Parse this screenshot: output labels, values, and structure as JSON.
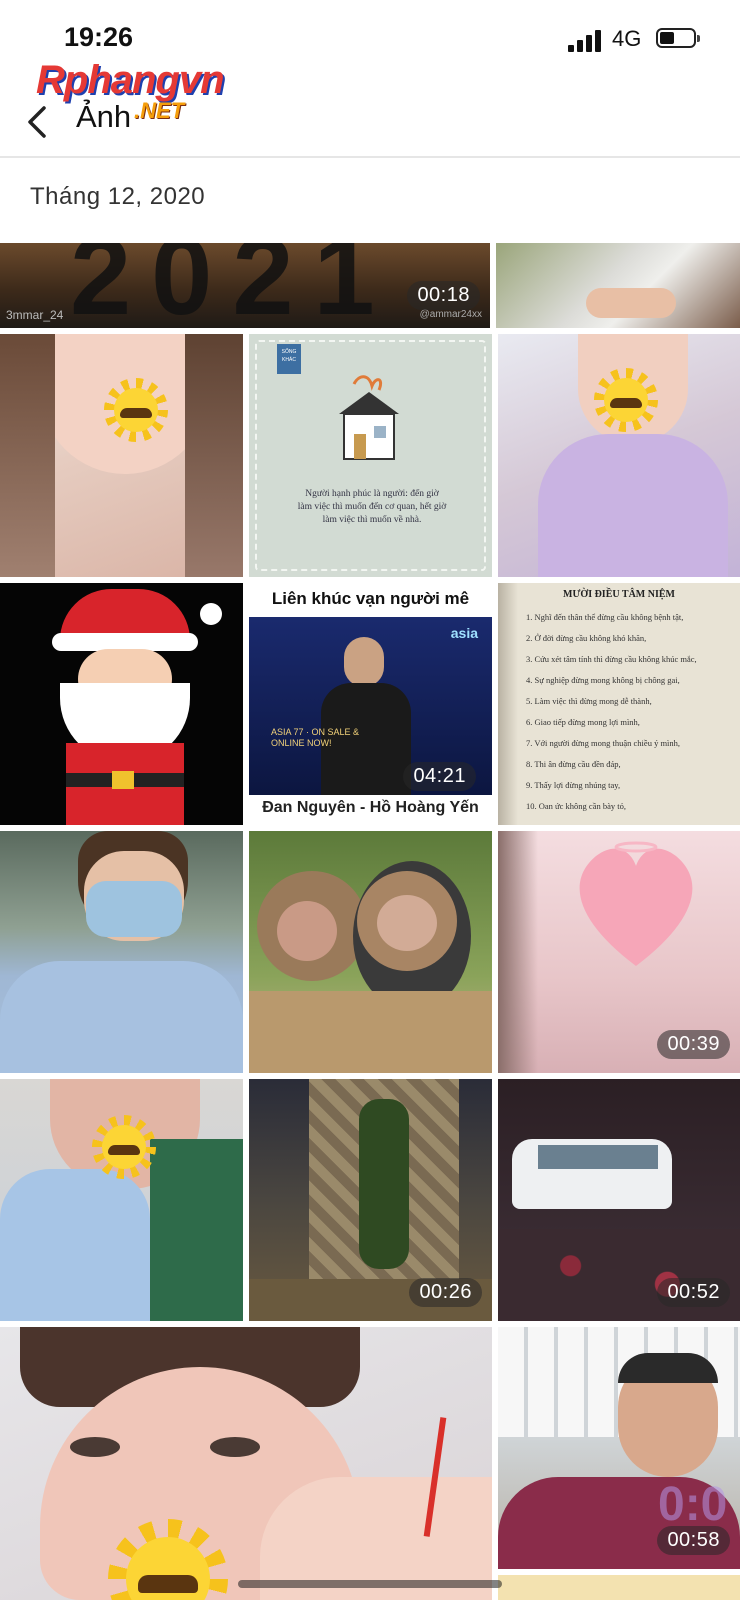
{
  "status_bar": {
    "time": "19:26",
    "network": "4G"
  },
  "watermark": {
    "brand": "Rphangvn",
    "suffix": ".NET"
  },
  "nav": {
    "back_icon": "chevron-left-icon",
    "title": "Ảnh"
  },
  "section": {
    "date": "Tháng 12, 2020"
  },
  "tiles": [
    {
      "name": "video-beach-2021",
      "duration": "00:18",
      "caption": "3mmar_24",
      "corner_text": "@ammar24xx"
    },
    {
      "name": "photo-hands",
      "duration": ""
    },
    {
      "name": "photo-selfie-1",
      "duration": ""
    },
    {
      "name": "photo-quote-house",
      "duration": "",
      "quote": "Người hạnh phúc là người: đến giờ làm việc thì muốn đến cơ quan, hết giờ làm việc thì muốn về nhà.",
      "tag": "SỐNG KHÁC"
    },
    {
      "name": "photo-selfie-2",
      "duration": ""
    },
    {
      "name": "photo-santa",
      "duration": ""
    },
    {
      "name": "video-lien-khuc",
      "duration": "04:21",
      "title": "Liên khúc vạn người mê",
      "subtitle": "Đan Nguyên - Hồ Hoàng Yến",
      "promo": "ASIA 77 · ON SALE & ONLINE NOW!"
    },
    {
      "name": "photo-muoi-dieu",
      "duration": "",
      "heading": "MƯỜI ĐIỀU TÂM NIỆM",
      "lines": [
        "1. Nghĩ đến thân thể đừng cầu không bệnh tật,",
        "2. Ở đời đừng cầu không khó khăn,",
        "3. Cứu xét tâm tính thì đừng cầu không khúc mắc,",
        "4. Sự nghiệp đừng mong không bị chông gai,",
        "5. Làm việc thì đừng mong dễ thành,",
        "6. Giao tiếp đừng mong lợi mình,",
        "7. Với người đừng mong thuận chiều ý mình,",
        "8. Thi ân đừng cầu đền đáp,",
        "9. Thấy lợi đừng nhúng tay,",
        "10. Oan ức không cần bày tỏ,"
      ]
    },
    {
      "name": "photo-mask-selfie",
      "duration": ""
    },
    {
      "name": "photo-monkeys",
      "duration": ""
    },
    {
      "name": "video-heart",
      "duration": "00:39"
    },
    {
      "name": "photo-selfie-3",
      "duration": ""
    },
    {
      "name": "video-night-temple",
      "duration": "00:26"
    },
    {
      "name": "video-street-van",
      "duration": "00:52"
    },
    {
      "name": "photo-selfie-big",
      "duration": ""
    },
    {
      "name": "video-man",
      "duration": "00:58"
    }
  ],
  "colors": {
    "accent": "#e53935",
    "badge_bg": "rgba(40,40,40,0.55)"
  }
}
